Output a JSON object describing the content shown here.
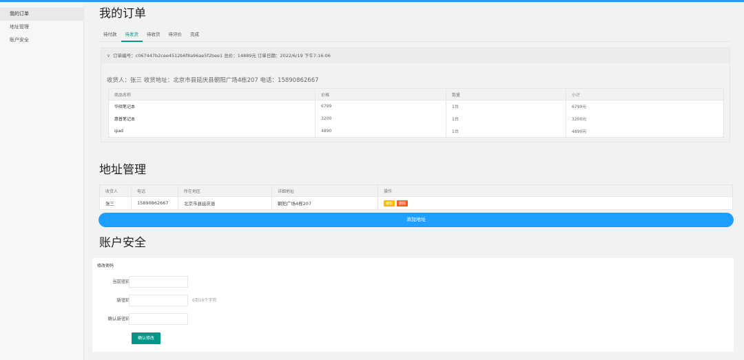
{
  "sidebar": {
    "items": [
      {
        "label": "我的订单"
      },
      {
        "label": "地址管理"
      },
      {
        "label": "账户安全"
      }
    ]
  },
  "orders": {
    "title": "我的订单",
    "tabs": [
      "待付款",
      "待发货",
      "待收货",
      "待评价",
      "完成"
    ],
    "active_tab": "待发货",
    "order": {
      "header": "订单编号：c067447b2cee4512b6f8a96ae5f2bee1   总价：14889元  订单日期：2022/6/19 下午7:16:06",
      "receiver": "收货人：张三   收货地址：北京市县延庆县朝阳广场4栋207  电话：15890862667",
      "columns": [
        "商品名称",
        "价格",
        "数量",
        "小计"
      ],
      "rows": [
        {
          "name": "华硕笔记本",
          "price": "6799",
          "qty": "1台",
          "subtotal": "6799元"
        },
        {
          "name": "惠普笔记本",
          "price": "3200",
          "qty": "1台",
          "subtotal": "3200元"
        },
        {
          "name": "ipad",
          "price": "4890",
          "qty": "1台",
          "subtotal": "4890元"
        }
      ]
    }
  },
  "address": {
    "title": "地址管理",
    "columns": [
      "收货人",
      "电话",
      "所在地区",
      "详细地址",
      "操作"
    ],
    "rows": [
      {
        "name": "张三",
        "phone": "15890862667",
        "region": "北京市县延庆县",
        "detail": "朝阳广场4栋207",
        "edit": "编辑",
        "delete": "删除"
      }
    ],
    "add_button": "添加地址"
  },
  "security": {
    "title": "账户安全",
    "section": "修改密码",
    "fields": {
      "current_password": {
        "label": "当前密码",
        "value": ""
      },
      "new_password": {
        "label": "新密码",
        "value": "",
        "hint": "6到16个字符"
      },
      "confirm_password": {
        "label": "确认新密码",
        "value": ""
      }
    },
    "submit": "确认修改"
  },
  "colors": {
    "accent_blue": "#1e9fff",
    "accent_green": "#009688",
    "edit_yellow": "#ffb800",
    "delete_orange": "#ff5722"
  }
}
